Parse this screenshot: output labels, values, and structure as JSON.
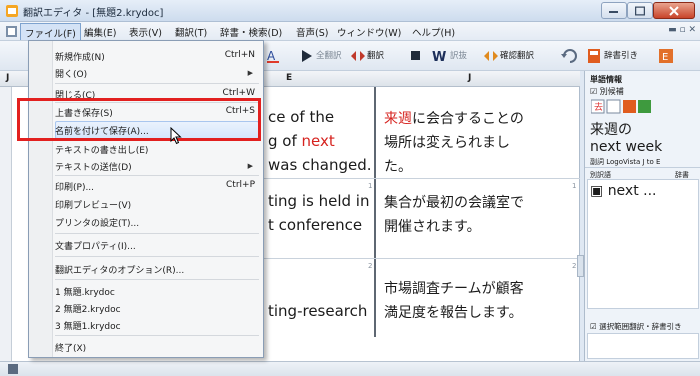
{
  "window": {
    "title": "翻訳エディタ - [無題2.krydoc]",
    "colors": {
      "highlight_box": "#e2201f",
      "red_text": "#d6231f"
    }
  },
  "menubar": {
    "items": [
      "ファイル(F)",
      "編集(E)",
      "表示(V)",
      "翻訳(T)",
      "辞書・検索(D)",
      "音声(S)",
      "ウィンドウ(W)",
      "ヘルプ(H)"
    ]
  },
  "toolbar": {
    "items": [
      "全翻訳",
      "翻訳",
      "訳抜",
      "確認翻訳",
      "辞書引き"
    ]
  },
  "file_menu": {
    "items": [
      {
        "label": "新規作成(N)",
        "shortcut": "Ctrl+N"
      },
      {
        "label": "開く(O)",
        "submenu": true
      },
      {
        "label": "閉じる(C)",
        "shortcut": "Ctrl+W"
      },
      {
        "label": "上書き保存(S)",
        "shortcut": "Ctrl+S"
      },
      {
        "label": "名前を付けて保存(A)..."
      },
      {
        "label": "テキストの書き出し(E)"
      },
      {
        "label": "テキストの送信(D)",
        "submenu": true
      },
      {
        "label": "印刷(P)...",
        "shortcut": "Ctrl+P"
      },
      {
        "label": "印刷プレビュー(V)"
      },
      {
        "label": "プリンタの設定(T)..."
      },
      {
        "label": "文書プロパティ(I)..."
      },
      {
        "label": "翻訳エディタのオプション(R)..."
      },
      {
        "label": "1 無題.krydoc"
      },
      {
        "label": "2 無題2.krydoc"
      },
      {
        "label": "3 無題1.krydoc"
      },
      {
        "label": "終了(X)"
      }
    ]
  },
  "editor": {
    "column_headers": [
      "J",
      "E",
      "J"
    ],
    "row_numbers": [
      "1",
      "2"
    ],
    "rows": [
      {
        "en": [
          "ce of the",
          "g of ",
          "next",
          "was changed."
        ],
        "ja": [
          "来週",
          "に会合することの",
          "場所は変えられまし",
          "た。"
        ]
      },
      {
        "en": [
          "ting is held in",
          "t conference"
        ],
        "ja": [
          "集合が最初の会議室で",
          "開催されます。"
        ]
      },
      {
        "en": [
          "ting-research"
        ],
        "ja": [
          "市場調査チームが顧客",
          "満足度を報告します。"
        ]
      }
    ]
  },
  "side_panel": {
    "header": "単語情報",
    "option_label": "別候補",
    "word": "来週の",
    "translation": "next week",
    "dict_label": "副詞 LogoVista J to E",
    "col_candidates": "別訳語",
    "col_dict": "辞書",
    "candidate": "next ...",
    "bottom_checkbox": "選択範囲翻訳・辞書引き"
  }
}
